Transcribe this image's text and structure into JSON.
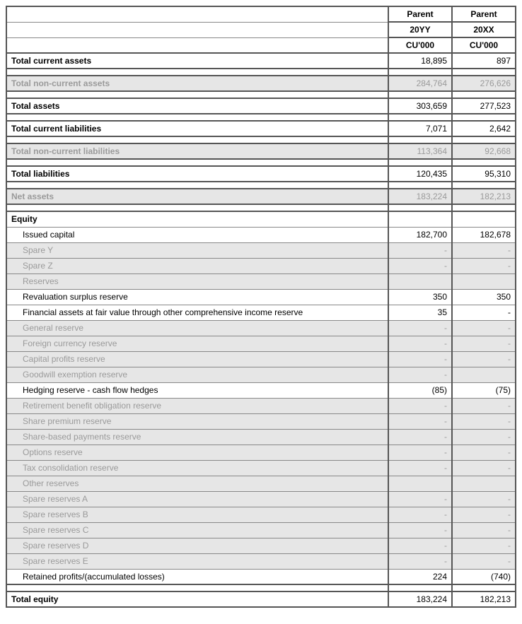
{
  "chart_data": {
    "type": "table",
    "title": "Parent entity financial summary",
    "columns": [
      "",
      "Parent 20YY CU'000",
      "Parent 20XX CU'000"
    ],
    "rows": [
      [
        "Total current assets",
        18895,
        897
      ],
      [
        "Total non-current assets",
        284764,
        276626
      ],
      [
        "Total assets",
        303659,
        277523
      ],
      [
        "Total current liabilities",
        7071,
        2642
      ],
      [
        "Total non-current liabilities",
        113364,
        92668
      ],
      [
        "Total liabilities",
        120435,
        95310
      ],
      [
        "Net assets",
        183224,
        182213
      ],
      [
        "Issued capital",
        182700,
        182678
      ],
      [
        "Revaluation surplus reserve",
        350,
        350
      ],
      [
        "Financial assets at fair value through other comprehensive income reserve",
        35,
        null
      ],
      [
        "Hedging reserve - cash flow hedges",
        -85,
        -75
      ],
      [
        "Retained profits/(accumulated losses)",
        224,
        -740
      ],
      [
        "Total equity",
        183224,
        182213
      ]
    ]
  },
  "hdr": {
    "parent": "Parent",
    "yy": "20YY",
    "xx": "20XX",
    "cu": "CU'000"
  },
  "r": {
    "tca": {
      "l": "Total current assets",
      "yy": "18,895",
      "xx": "897"
    },
    "tnca": {
      "l": "Total non-current assets",
      "yy": "284,764",
      "xx": "276,626"
    },
    "ta": {
      "l": "Total assets",
      "yy": "303,659",
      "xx": "277,523"
    },
    "tcl": {
      "l": "Total current liabilities",
      "yy": "7,071",
      "xx": "2,642"
    },
    "tncl": {
      "l": "Total non-current liabilities",
      "yy": "113,364",
      "xx": "92,668"
    },
    "tl": {
      "l": "Total liabilities",
      "yy": "120,435",
      "xx": "95,310"
    },
    "na": {
      "l": "Net assets",
      "yy": "183,224",
      "xx": "182,213"
    },
    "equity": {
      "l": "Equity"
    },
    "ic": {
      "l": "Issued capital",
      "yy": "182,700",
      "xx": "182,678"
    },
    "sy": {
      "l": "Spare Y",
      "yy": "-",
      "xx": "-"
    },
    "sz": {
      "l": "Spare Z",
      "yy": "-",
      "xx": "-"
    },
    "res": {
      "l": "Reserves",
      "yy": "",
      "xx": ""
    },
    "rev": {
      "l": "Revaluation surplus reserve",
      "yy": "350",
      "xx": "350"
    },
    "fafv": {
      "l": "Financial assets at fair value through other comprehensive income reserve",
      "yy": "35",
      "xx": "-"
    },
    "gen": {
      "l": "General reserve",
      "yy": "-",
      "xx": "-"
    },
    "fcr": {
      "l": "Foreign currency reserve",
      "yy": "-",
      "xx": "-"
    },
    "cpr": {
      "l": "Capital profits reserve",
      "yy": "-",
      "xx": "-"
    },
    "ger": {
      "l": "Goodwill exemption reserve",
      "yy": "-",
      "xx": ""
    },
    "hed": {
      "l": "Hedging reserve - cash flow hedges",
      "yy": "(85)",
      "xx": "(75)"
    },
    "rbo": {
      "l": "Retirement benefit obligation reserve",
      "yy": "-",
      "xx": "-"
    },
    "spr": {
      "l": "Share premium reserve",
      "yy": "-",
      "xx": "-"
    },
    "sbp": {
      "l": "Share-based payments reserve",
      "yy": "-",
      "xx": "-"
    },
    "opt": {
      "l": "Options reserve",
      "yy": "-",
      "xx": "-"
    },
    "tcr": {
      "l": "Tax consolidation reserve",
      "yy": "-",
      "xx": "-"
    },
    "oth": {
      "l": "Other reserves",
      "yy": "",
      "xx": ""
    },
    "sra": {
      "l": "Spare reserves A",
      "yy": "-",
      "xx": "-"
    },
    "srb": {
      "l": "Spare reserves B",
      "yy": "-",
      "xx": "-"
    },
    "src": {
      "l": "Spare reserves C",
      "yy": "-",
      "xx": "-"
    },
    "srd": {
      "l": "Spare reserves D",
      "yy": "-",
      "xx": "-"
    },
    "sre": {
      "l": "Spare reserves E",
      "yy": "-",
      "xx": "-"
    },
    "rp": {
      "l": "Retained profits/(accumulated losses)",
      "yy": "224",
      "xx": "(740)"
    },
    "te": {
      "l": "Total equity",
      "yy": "183,224",
      "xx": "182,213"
    }
  }
}
